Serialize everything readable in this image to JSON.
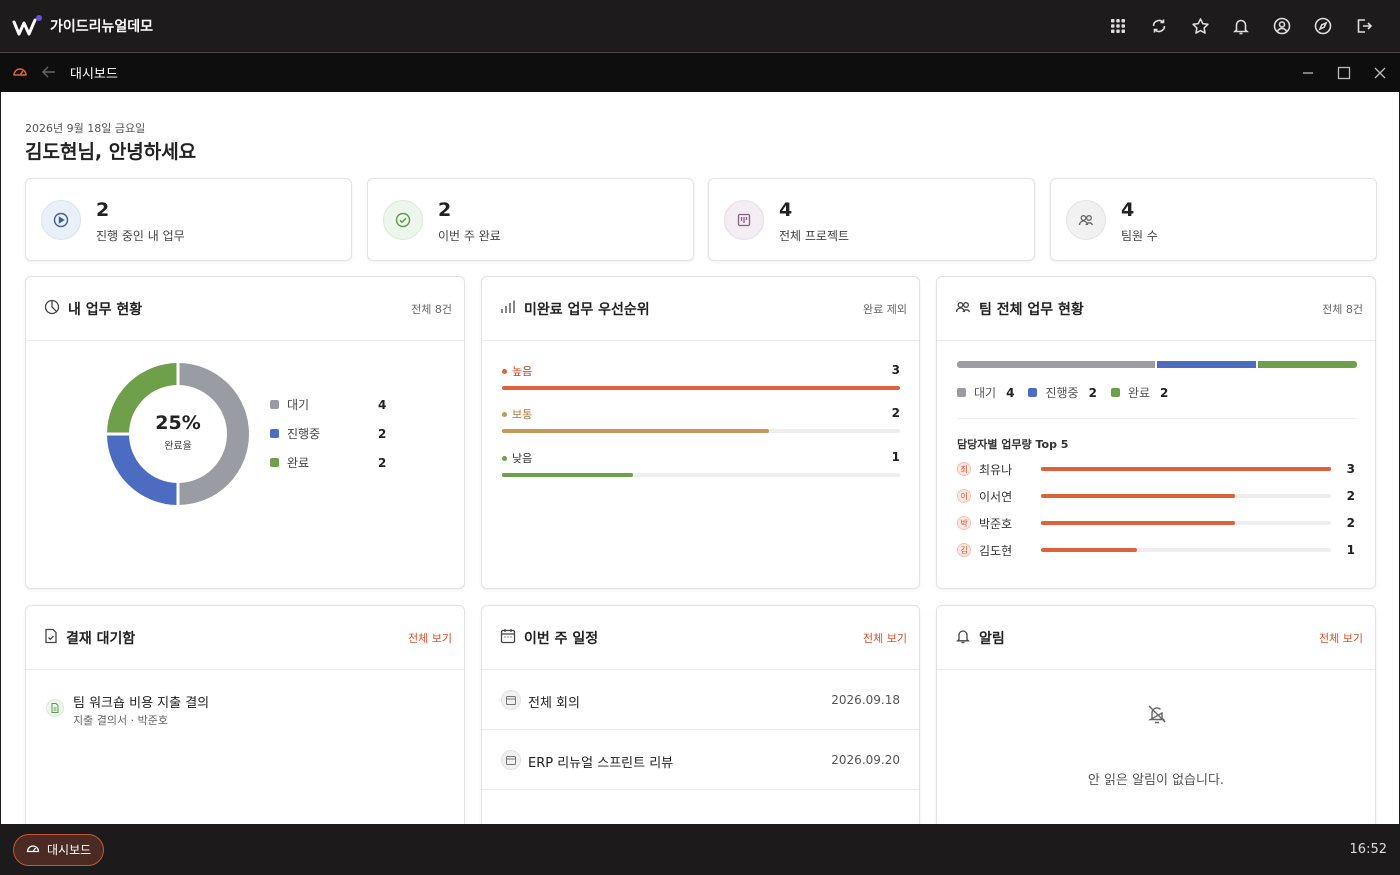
{
  "app": {
    "title": "가이드리뉴얼데모"
  },
  "window": {
    "title": "대시보드"
  },
  "header": {
    "date": "2026년 9월 18일 금요일",
    "greeting": "김도현님, 안녕하세요"
  },
  "stats": [
    {
      "value": "2",
      "label": "진행 중인 내 업무",
      "icon": "play-circle-icon"
    },
    {
      "value": "2",
      "label": "이번 주 완료",
      "icon": "check-circle-icon"
    },
    {
      "value": "4",
      "label": "전체 프로젝트",
      "icon": "project-icon"
    },
    {
      "value": "4",
      "label": "팀원 수",
      "icon": "users-icon"
    }
  ],
  "my_tasks": {
    "title": "내 업무 현황",
    "meta": "전체 8건",
    "center_value": "25%",
    "center_label": "완료율",
    "legend": [
      {
        "label": "대기",
        "value": "4",
        "color": "#9a9ca3"
      },
      {
        "label": "진행중",
        "value": "2",
        "color": "#4b6cc1"
      },
      {
        "label": "완료",
        "value": "2",
        "color": "#6ea04b"
      }
    ]
  },
  "priority": {
    "title": "미완료 업무 우선순위",
    "meta": "완료 제외",
    "items": [
      {
        "label": "높음",
        "value": "3",
        "fraction": 1.0,
        "color": "#e0603c"
      },
      {
        "label": "보통",
        "value": "2",
        "fraction": 0.67,
        "color": "#c6965a"
      },
      {
        "label": "낮음",
        "value": "1",
        "fraction": 0.33,
        "color": "#6ea04b"
      }
    ]
  },
  "team": {
    "title": "팀 전체 업무 현황",
    "meta": "전체 8건",
    "segments": [
      {
        "label": "대기",
        "value": "4",
        "color": "#9a9ca3"
      },
      {
        "label": "진행중",
        "value": "2",
        "color": "#4b6cc1"
      },
      {
        "label": "완료",
        "value": "2",
        "color": "#6ea04b"
      }
    ],
    "top_title": "담당자별 업무량 Top 5",
    "members": [
      {
        "initial": "최",
        "name": "최유나",
        "value": "3",
        "fraction": 1.0
      },
      {
        "initial": "이",
        "name": "이서연",
        "value": "2",
        "fraction": 0.67
      },
      {
        "initial": "박",
        "name": "박준호",
        "value": "2",
        "fraction": 0.67
      },
      {
        "initial": "김",
        "name": "김도현",
        "value": "1",
        "fraction": 0.33
      }
    ]
  },
  "approvals": {
    "title": "결재 대기함",
    "link": "전체 보기",
    "items": [
      {
        "title": "팀 워크숍 비용 지출 결의",
        "sub": "지출 결의서 · 박준호"
      }
    ]
  },
  "schedule": {
    "title": "이번 주 일정",
    "link": "전체 보기",
    "items": [
      {
        "title": "전체 회의",
        "date": "2026.09.18"
      },
      {
        "title": "ERP 리뉴얼 스프린트 리뷰",
        "date": "2026.09.20"
      }
    ]
  },
  "notifications": {
    "title": "알림",
    "link": "전체 보기",
    "empty": "안 읽은 알림이 없습니다."
  },
  "taskbar": {
    "button": "대시보드",
    "clock": "16:52"
  },
  "colors": {
    "accent": "#d9532f",
    "dark_bg": "#1d1b1c"
  }
}
